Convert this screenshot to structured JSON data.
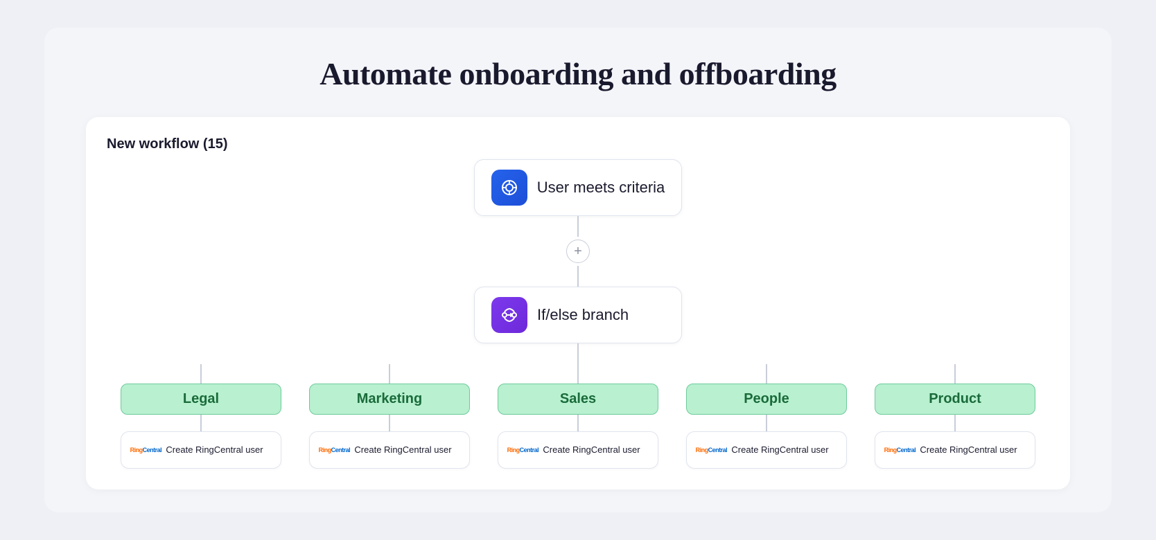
{
  "page": {
    "title": "Automate onboarding and offboarding"
  },
  "workflow": {
    "title": "New workflow (15)",
    "nodes": {
      "trigger": {
        "label": "User meets criteria",
        "icon_type": "blue"
      },
      "add_button": "+",
      "branch": {
        "label": "If/else branch",
        "icon_type": "purple"
      }
    },
    "branches": [
      {
        "tag": "Legal",
        "sub_label": "Create RingCentral user"
      },
      {
        "tag": "Marketing",
        "sub_label": "Create RingCentral user"
      },
      {
        "tag": "Sales",
        "sub_label": "Create RingCentral user"
      },
      {
        "tag": "People",
        "sub_label": "Create RingCentral user"
      },
      {
        "tag": "Product",
        "sub_label": "Create RingCentral user"
      }
    ]
  }
}
